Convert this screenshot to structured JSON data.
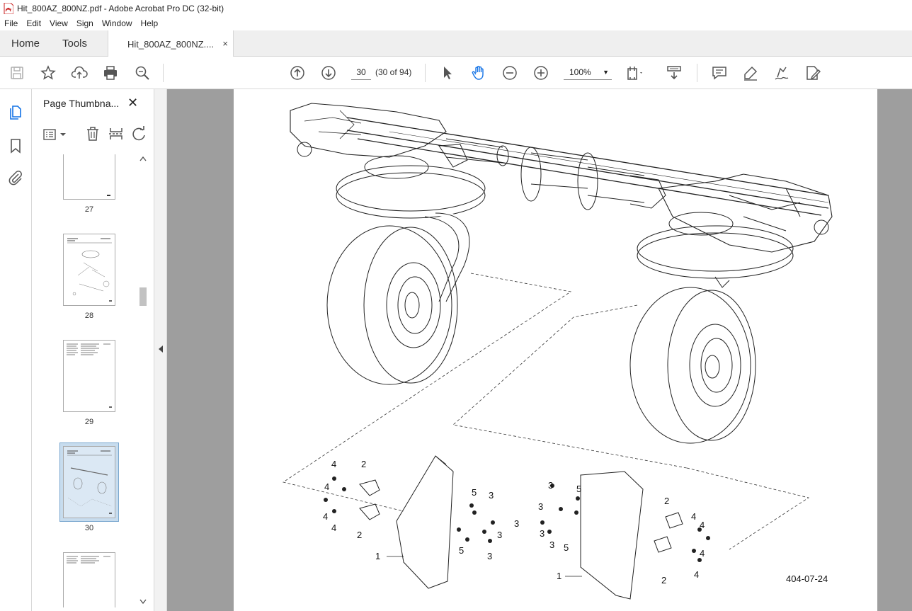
{
  "window": {
    "title": "Hit_800AZ_800NZ.pdf - Adobe Acrobat Pro DC (32-bit)"
  },
  "menu": [
    "File",
    "Edit",
    "View",
    "Sign",
    "Window",
    "Help"
  ],
  "tabs": {
    "home": "Home",
    "tools": "Tools",
    "doc": "Hit_800AZ_800NZ....",
    "close": "×"
  },
  "toolbar": {
    "page_current": "30",
    "page_count": "(30 of 94)",
    "zoom": "100%",
    "icons": [
      "save-icon",
      "bookmark-star-icon",
      "upload-icon",
      "print-icon",
      "search-zoom-icon",
      "prev-page-icon",
      "next-page-icon",
      "select-arrow-icon",
      "hand-tool-icon",
      "zoom-out-icon",
      "zoom-in-icon",
      "fit-page-icon",
      "scroll-mode-icon",
      "comment-icon",
      "highlight-icon",
      "sign-icon",
      "fill-sign-icon"
    ]
  },
  "sidebar": {
    "title": "Page Thumbna...",
    "close": "✕",
    "thumbnails": [
      {
        "label": "27"
      },
      {
        "label": "28"
      },
      {
        "label": "29"
      },
      {
        "label": "30",
        "selected": true
      },
      {
        "label": ""
      }
    ]
  },
  "document": {
    "figure_id": "404-07-24",
    "callouts_left": [
      "4",
      "2",
      "4",
      "4",
      "4",
      "2",
      "1",
      "5",
      "3",
      "3",
      "3",
      "5",
      "3"
    ],
    "callouts_right": [
      "3",
      "5",
      "3",
      "3",
      "3",
      "5",
      "2",
      "4",
      "4",
      "4",
      "4",
      "2",
      "1"
    ]
  },
  "colors": {
    "accent": "#1473e6",
    "panel_bg": "#9e9e9e"
  }
}
